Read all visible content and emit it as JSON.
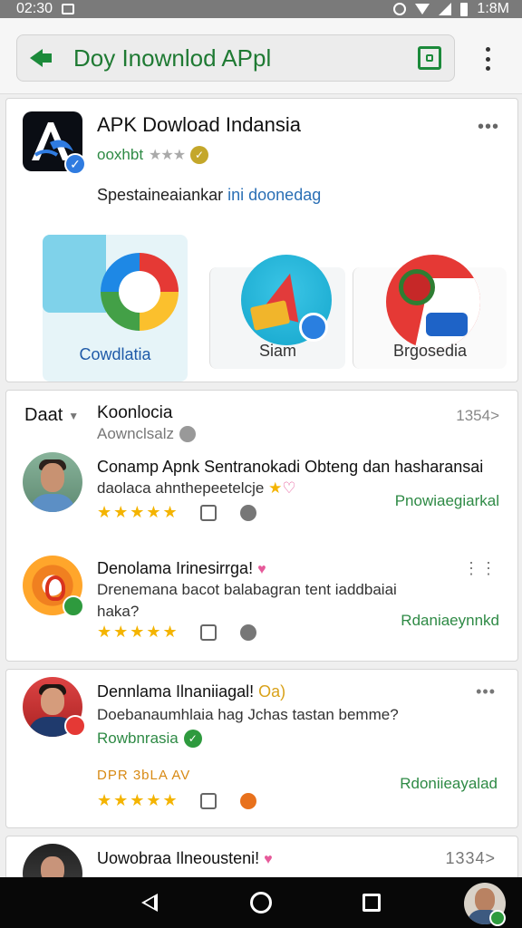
{
  "status_bar": {
    "time": "02:30",
    "clock": "1:8M"
  },
  "app_bar": {
    "title": "Doy Inownlod APpl"
  },
  "hero": {
    "title": "APK Dowload Indansia",
    "subtitle": "ooxhbt",
    "stars": "★★★",
    "menu": "•••",
    "description": "Spestaineaiankar",
    "description_link": "ini doonedag",
    "tiles": [
      {
        "label": "Cowdlatia"
      },
      {
        "label": "Siam"
      },
      {
        "label": "Brgosedia"
      }
    ]
  },
  "reviews": {
    "header_left": "Daat",
    "title": "Koonlocia",
    "subtitle": "Aownclsalz",
    "count": "1354>",
    "items": [
      {
        "title": "Conamp Apnk Sentranokadi Obteng dan hasharansai",
        "text": "daolaca ahnthepeetelcje",
        "link": "Pnowiaegiarkal",
        "stars": "★★★★★"
      },
      {
        "title": "Denolama Irinesirrga!",
        "text_line1": "Drenemana bacot balabagran tent iaddbaiai",
        "text_line2": "haka?",
        "link": "Rdaniaeynnkd",
        "stars": "★★★★★",
        "menu": "⋮⋮"
      }
    ]
  },
  "review2": {
    "title": "Dennlama Ilnaniiagal!",
    "title_suffix": "Oa)",
    "text": "Doebanaumhlaia hag Jchas tastan bemme?",
    "verified": "Rowbnrasia",
    "code": "DPR 3bLA AV",
    "link": "Rdoniieayalad",
    "stars": "★★★★★",
    "menu": "•••"
  },
  "review3": {
    "title": "Uowobraa Ilneousteni!",
    "count": "1334>"
  },
  "colors": {
    "accent_green": "#1b8a3a",
    "star": "#f4b400",
    "link_blue": "#2a6fb5"
  }
}
